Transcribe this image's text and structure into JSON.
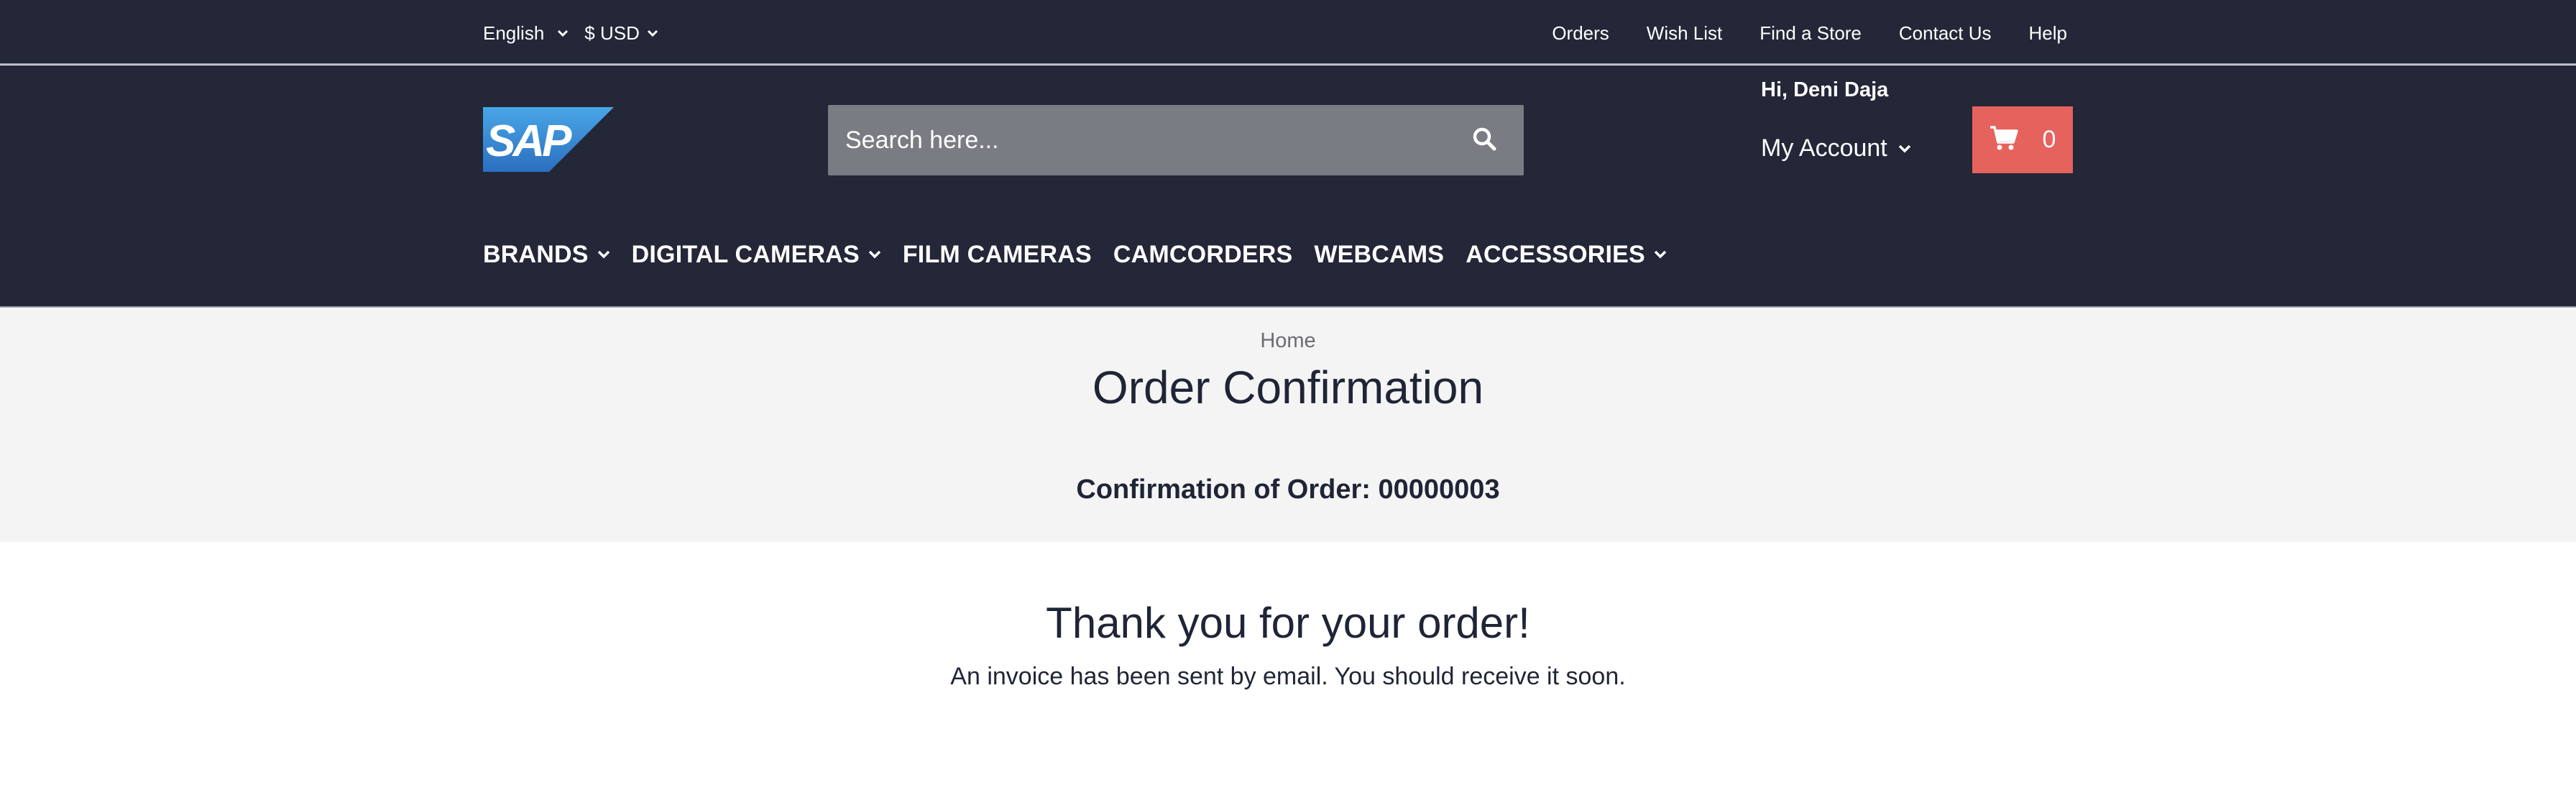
{
  "topbar": {
    "language": "English",
    "currency": "$ USD",
    "links": [
      "Orders",
      "Wish List",
      "Find a Store",
      "Contact Us",
      "Help"
    ]
  },
  "header": {
    "search_placeholder": "Search here...",
    "greeting": "Hi, Deni Daja",
    "account_label": "My Account",
    "cart_count": "0"
  },
  "nav": {
    "items": [
      "BRANDS",
      "DIGITAL CAMERAS",
      "FILM CAMERAS",
      "CAMCORDERS",
      "WEBCAMS",
      "ACCESSORIES"
    ]
  },
  "hero": {
    "breadcrumb": "Home",
    "title": "Order Confirmation",
    "order_label": "Confirmation of Order: 00000003"
  },
  "body": {
    "thanks": "Thank you for your order!",
    "invoice_note": "An invoice has been sent by email. You should receive it soon."
  },
  "colors": {
    "header_bg": "#232738",
    "cart_bg": "#e6625d",
    "search_bg": "#7a7c83",
    "hero_bg": "#f4f4f4"
  },
  "icons": [
    "chevron-down-icon",
    "search-icon",
    "cart-icon",
    "sap-logo"
  ]
}
